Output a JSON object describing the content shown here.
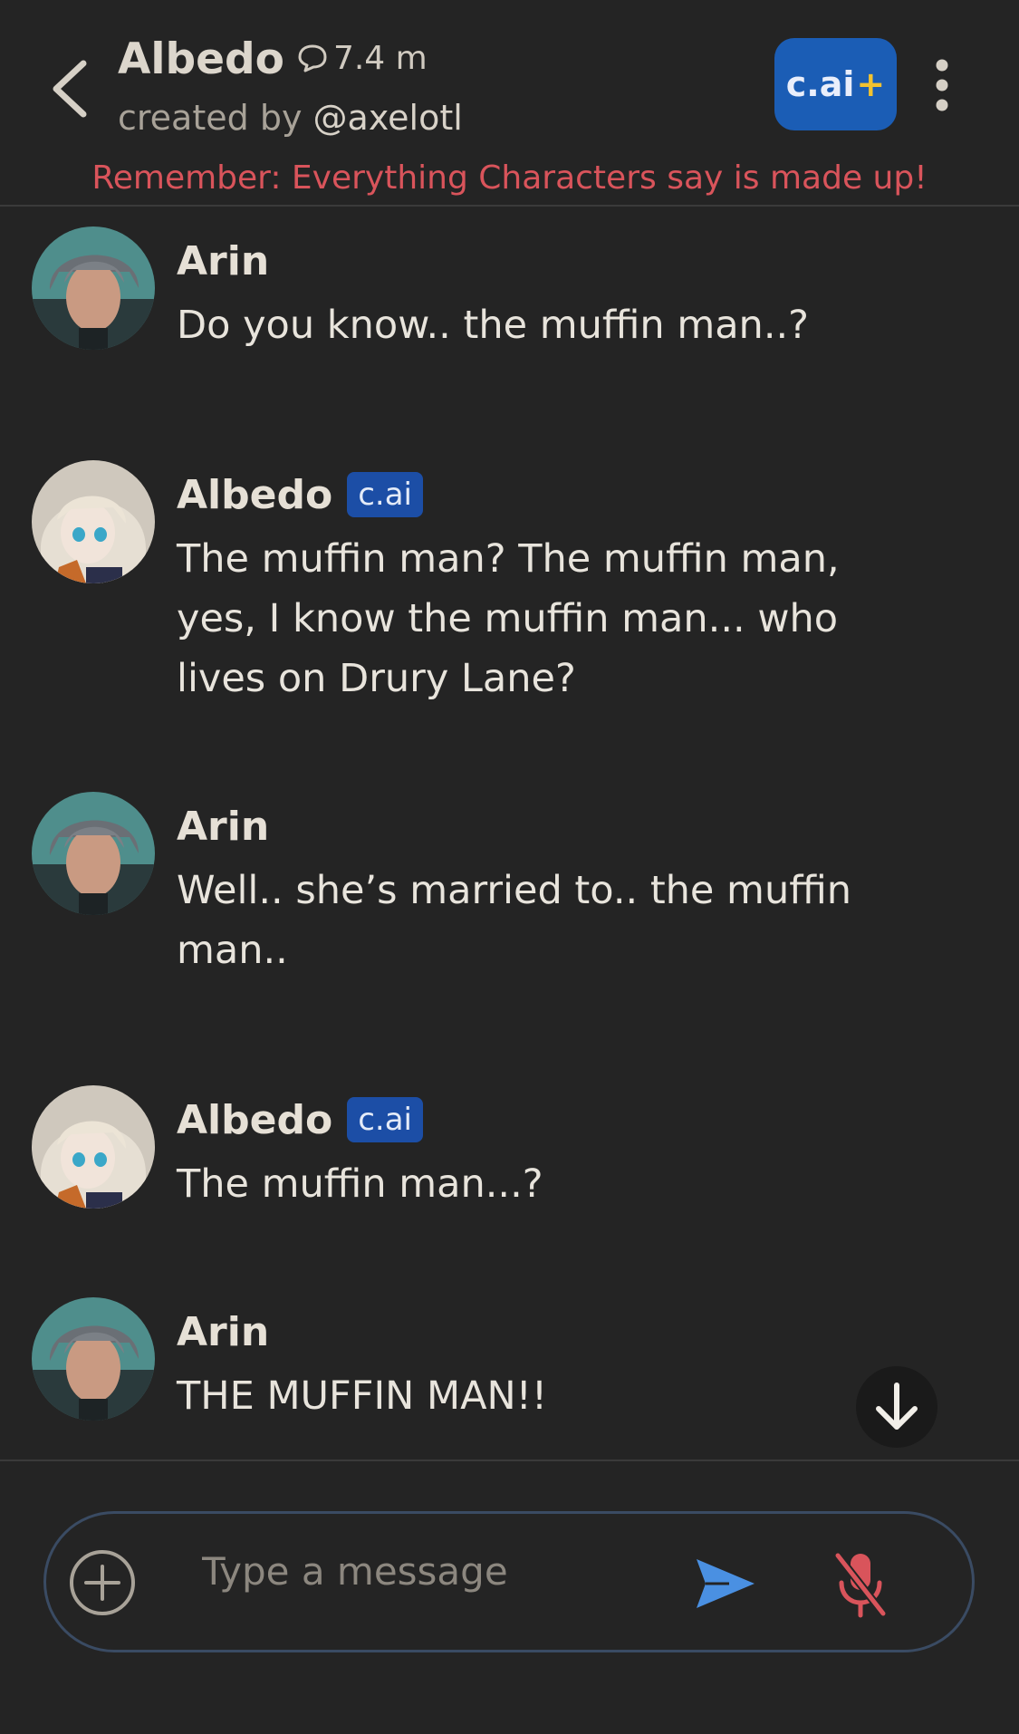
{
  "header": {
    "title": "Albedo",
    "chat_count": "7.4 m",
    "creator_prefix": "created by",
    "creator_handle": "@axelotl",
    "plus_label": "c.ai",
    "plus_symbol": "+",
    "warning": "Remember: Everything Characters say is made up!"
  },
  "messages": [
    {
      "name": "Arin",
      "text": "Do you know.. the muffin man..?",
      "badge": ""
    },
    {
      "name": "Albedo",
      "badge": "c.ai",
      "text": "The muffin man? The muffin man, yes, I know the muffin man... who lives on Drury Lane?"
    },
    {
      "name": "Arin",
      "text": "Well.. she’s married to.. the muffin man..",
      "badge": ""
    },
    {
      "name": "Albedo",
      "badge": "c.ai",
      "text": "The muffin man...?"
    },
    {
      "name": "Arin",
      "text": "THE MUFFIN MAN!!",
      "badge": ""
    }
  ],
  "composer": {
    "placeholder": "Type a message"
  },
  "colors": {
    "background": "#242424",
    "accent_blue": "#1b5db5",
    "warning_red": "#d9545b",
    "send_blue": "#4a90e2",
    "mic_red": "#d9545b"
  },
  "icons": {
    "back": "chevron-left-icon",
    "chat": "chat-bubble-icon",
    "menu": "more-vertical-icon",
    "scroll": "arrow-down-icon",
    "add": "plus-circle-icon",
    "send": "send-icon",
    "mic": "mic-off-icon"
  }
}
